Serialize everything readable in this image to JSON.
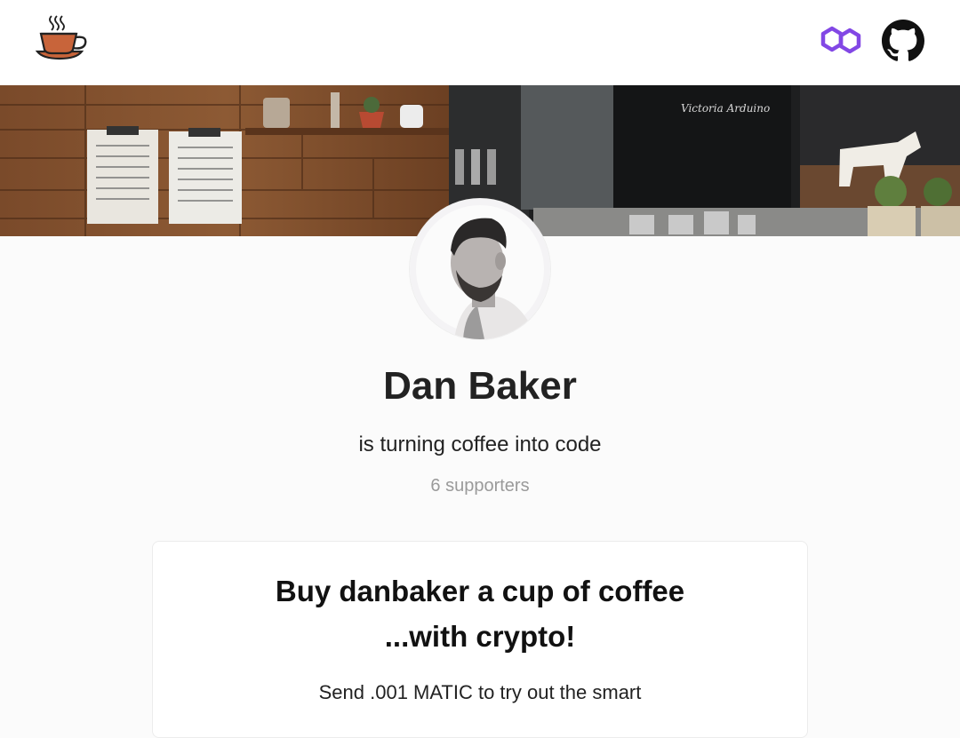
{
  "header": {
    "logo_icon": "coffee-cup-icon",
    "polygon_icon": "polygon-matic-icon",
    "github_icon": "github-icon",
    "accent_color": "#8247e5"
  },
  "profile": {
    "name": "Dan Baker",
    "tagline": "is turning coffee into code",
    "supporters": "6 supporters"
  },
  "card": {
    "title_line1": "Buy danbaker a cup of coffee",
    "title_line2": "...with crypto!",
    "body": "Send .001 MATIC to try out the smart"
  }
}
